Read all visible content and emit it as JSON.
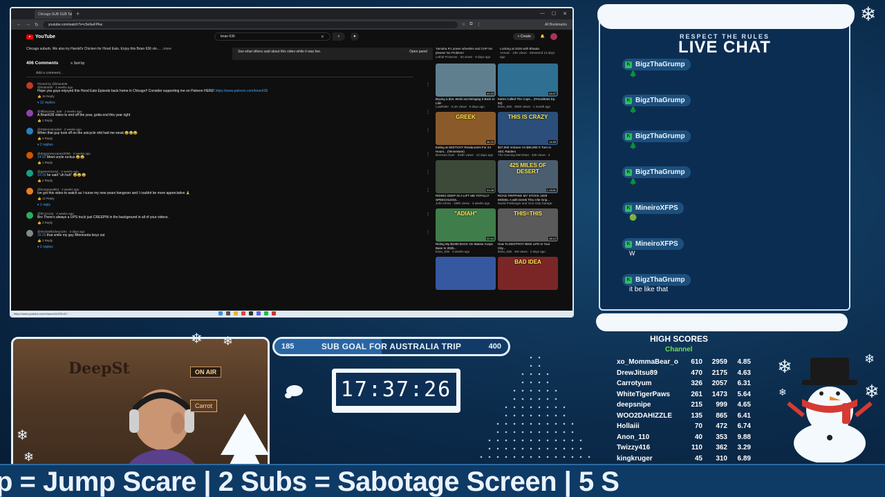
{
  "browser": {
    "tabs": [
      "Chicago SUB SUB Talk",
      "YouTube"
    ],
    "url": "youtube.com/watch?v=c5e6wFPkw",
    "bookmarks_label": "All Bookmarks",
    "status_url": "https://www.youtube.com/channel/UCRm0?...",
    "youtube": {
      "logo_text": "YouTube",
      "search_value": "brian 636",
      "create_label": "+ Create",
      "description_line": "Chicago suburb. We also try Harold's Chicken for Hood Eats. Enjoy this Brian 636 vlo...",
      "description_more": "...more",
      "comments_count": "406 Comments",
      "sort_label": "Sort by",
      "add_comment_placeholder": "Add a comment...",
      "prev_overlay_text": "See what others said about this video while it was live.",
      "prev_overlay_btn": "Open panel",
      "comments": [
        {
          "user": "@brian636 · 2 weeks ago",
          "pinned": "Pinned by @brian636",
          "text": "Hope you guys enjoyed this Hood Eats Episode back home in Chicago!! Consider supporting me on Patreon HERE!",
          "link": "https://www.patreon.com/brian636",
          "actions": "15  Reply",
          "replies": "12 replies",
          "color": "#c0392b"
        },
        {
          "user": "@tiffanyrose_636 · 2 weeks ago",
          "text": "A Brian636 video to end off the year, gotta end this year right",
          "actions": "1  Reply",
          "color": "#8e44ad"
        },
        {
          "user": "@Stylenotmoded · 2 weeks ago",
          "text": "When that guy took off on the unicycle shit had me weak 😂😂😂",
          "actions": "3  Reply",
          "replies": "2 replies",
          "color": "#2980b9"
        },
        {
          "user": "@dragonesscanes2008 · 2 weeks ago",
          "ts": "14:02",
          "text": "Meet uncle ruckus 😂😂",
          "actions": "1  Reply",
          "color": "#d35400"
        },
        {
          "user": "@gamerniceryl · 2 weeks ago",
          "ts": "10:16",
          "text": "he said \"uh huh\" 😂😂😂",
          "actions": "2  Reply",
          "color": "#16a085"
        },
        {
          "user": "@bongwow864 · 2 weeks ago",
          "text": "Ive got this video to watch as I nurse my new years hangover and I couldnt be more appreciative 🙏",
          "actions": "12  Reply",
          "replies": "1 reply",
          "color": "#e67e22"
        },
        {
          "user": "@bh.tm142 · 2 weeks ago",
          "text": "Bro There's always a UPS truck just CREEPIN in the background in all of your videos.",
          "actions": "3  Reply",
          "color": "#27ae60"
        },
        {
          "user": "@michaelbickey1191 · 3 days ago",
          "ts": "16:15",
          "text": "that smile my guy Minnesota boyz out",
          "actions": "1  Reply",
          "replies": "2 replies",
          "color": "#7f8c8d"
        }
      ],
      "side_top": [
        {
          "title": "Yamaha R1 power wheelies and CHP No please! No Problem!",
          "meta": "Lethal Protector · 54 views · 9 days ago"
        },
        {
          "title": "Looking at 2026 with Bhaata",
          "meta": "Armani · 10K views · Streamed 13 days ago"
        }
      ],
      "videos": [
        {
          "title": "Buying a $15 Jetski and Bringing It Back to Life!",
          "meta": "LowRider · 9.1K views · 9 days ago",
          "dur": "41:23",
          "bg": "#5f7f8f"
        },
        {
          "title": "Karen Called The Cops... (#HoodEats Ep. 92)",
          "meta": "brian_636 · 302K views · 1 month ago",
          "dur": "24:07",
          "bg": "#2f6f92"
        },
        {
          "title": "Eating at SKETCHY Restaurants For 24 Hours... (Tennessee)",
          "meta": "Brennan Dyer · 333K views · 12 days ago",
          "dur": "36:25",
          "bg": "#8a5a2b",
          "overlay": "GREEK"
        },
        {
          "title": "$47,000 Volcano Vs $36,000 X Turn to AEC Raiders",
          "meta": "The Gaming Merchant · 348 views · 3 weeks ago",
          "dur": "14:58",
          "bg": "#2b4f7a",
          "overlay": "THIS IS CRAZY"
        },
        {
          "title": "RIDING DEEP IN A LIFT ME TOTALLY SPEECHLESS...",
          "meta": "John Hicks · 199K views · 3 weeks ago",
          "dur": "31:08",
          "bg": "#3d4a3a"
        },
        {
          "title": "ROAD TRIPPING MY STOCK 1929 MODEL A with Derek Thru Vite Grip...",
          "meta": "David Freiburger and Vice Grip Garage · 258K views · 13 hours ago",
          "dur": "1:13:51",
          "bg": "#4b5e6f",
          "overlay": "425 MILES OF DESERT"
        },
        {
          "title": "Riding My $1000 BACK On Marine Corps Base In 2025...",
          "meta": "brian_636 · 3 weeks ago",
          "dur": "22:44",
          "bg": "#3f7d4a",
          "overlay": "\"ADIAH\""
        },
        {
          "title": "How To DESTROY BIKE LIFE In Your City...",
          "meta": "brian_636 · 4M views · 2 days ago",
          "dur": "18:12",
          "bg": "#5a5a5a",
          "overlay": "THIS=THIS"
        },
        {
          "title": "",
          "meta": "",
          "dur": "",
          "bg": "#3558a0"
        },
        {
          "title": "",
          "meta": "",
          "dur": "",
          "bg": "#7a2626",
          "overlay": "BAD IDEA"
        }
      ]
    }
  },
  "chat": {
    "kicker": "RESPECT THE RULES",
    "title": "LIVE CHAT",
    "messages": [
      {
        "user": "BigzThaGrump",
        "text": "🌲"
      },
      {
        "user": "BigzThaGrump",
        "text": "🌲"
      },
      {
        "user": "BigzThaGrump",
        "text": "🌲"
      },
      {
        "user": "BigzThaGrump",
        "text": "🌲"
      },
      {
        "user": "MineiroXFPS",
        "text": "🟢"
      },
      {
        "user": "MineiroXFPS",
        "text": "W"
      },
      {
        "user": "BigzThaGrump",
        "text": "it be like that"
      }
    ]
  },
  "webcam": {
    "sign_text": "DeepSt",
    "on_air": "ON AIR",
    "carrot_sign": "Carrot"
  },
  "subgoal": {
    "low": "185",
    "title": "SUB GOAL FOR AUSTRALIA TRIP",
    "high": "400",
    "progress_fraction": 0.46
  },
  "timer": {
    "value": "17:37:26"
  },
  "scores": {
    "title": "HIGH SCORES",
    "subtitle": "Channel",
    "rows": [
      [
        "xo_MommaBear_o",
        "610",
        "2959",
        "4.85"
      ],
      [
        "DrewJitsu89",
        "470",
        "2175",
        "4.63"
      ],
      [
        "Carrotyum",
        "326",
        "2057",
        "6.31"
      ],
      [
        "WhiteTigerPaws",
        "261",
        "1473",
        "5.64"
      ],
      [
        "deepsnipe",
        "215",
        "999",
        "4.65"
      ],
      [
        "WOO2DAHIZZLE",
        "135",
        "865",
        "6.41"
      ],
      [
        "Hollaiii",
        "70",
        "472",
        "6.74"
      ],
      [
        "Anon_110",
        "40",
        "353",
        "9.88"
      ],
      [
        "Twizzy416",
        "110",
        "362",
        "3.29"
      ],
      [
        "kingkruger",
        "45",
        "310",
        "6.89"
      ]
    ]
  },
  "ticker": {
    "text": "p = Jump Scare | 2 Subs = Sabotage Screen | 5 S"
  },
  "colors": {
    "accent": "#2ebd65",
    "panel": "#0c2d52",
    "snow": "#f3f8fc"
  }
}
